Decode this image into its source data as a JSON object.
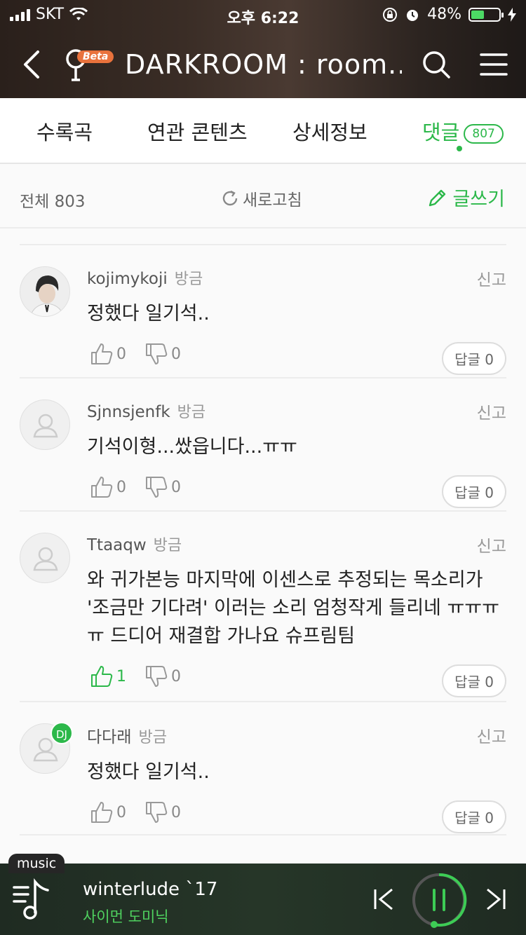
{
  "status": {
    "carrier": "SKT",
    "time": "오후 6:22",
    "battery": "48%"
  },
  "header": {
    "title": "DARKROOM : room...",
    "beta": "Beta"
  },
  "tabs": [
    {
      "label": "수록곡"
    },
    {
      "label": "연관 콘텐츠"
    },
    {
      "label": "상세정보"
    },
    {
      "label": "댓글",
      "badge": "807"
    }
  ],
  "toolbar": {
    "total": "전체 803",
    "refresh": "새로고침",
    "write": "글쓰기"
  },
  "comments": [
    {
      "user": "kojimykoji",
      "time": "방금",
      "report": "신고",
      "text": "정했다 일기석..",
      "likes": "0",
      "dislikes": "0",
      "reply": "답글 0"
    },
    {
      "user": "Sjnnsjenfk",
      "time": "방금",
      "report": "신고",
      "text": "기석이형...쌌읍니다...ㅠㅠ",
      "likes": "0",
      "dislikes": "0",
      "reply": "답글 0"
    },
    {
      "user": "Ttaaqw",
      "time": "방금",
      "report": "신고",
      "text": "와 귀가본능 마지막에 이센스로 추정되는 목소리가 '조금만 기다려' 이러는 소리 엄청작게 들리네 ㅠㅠㅠㅠ 드디어 재결합 가나요 슈프림팀",
      "likes": "1",
      "dislikes": "0",
      "reply": "답글 0"
    },
    {
      "user": "다다래",
      "time": "방금",
      "report": "신고",
      "text": "정했다 일기석..",
      "likes": "0",
      "dislikes": "0",
      "reply": "답글 0",
      "dj": "DJ"
    }
  ],
  "player": {
    "tag": "music",
    "song": "winterlude `17",
    "artist": "사이먼 도미닉"
  },
  "colors": {
    "accent": "#2cb84a",
    "beta": "#e9723c"
  }
}
